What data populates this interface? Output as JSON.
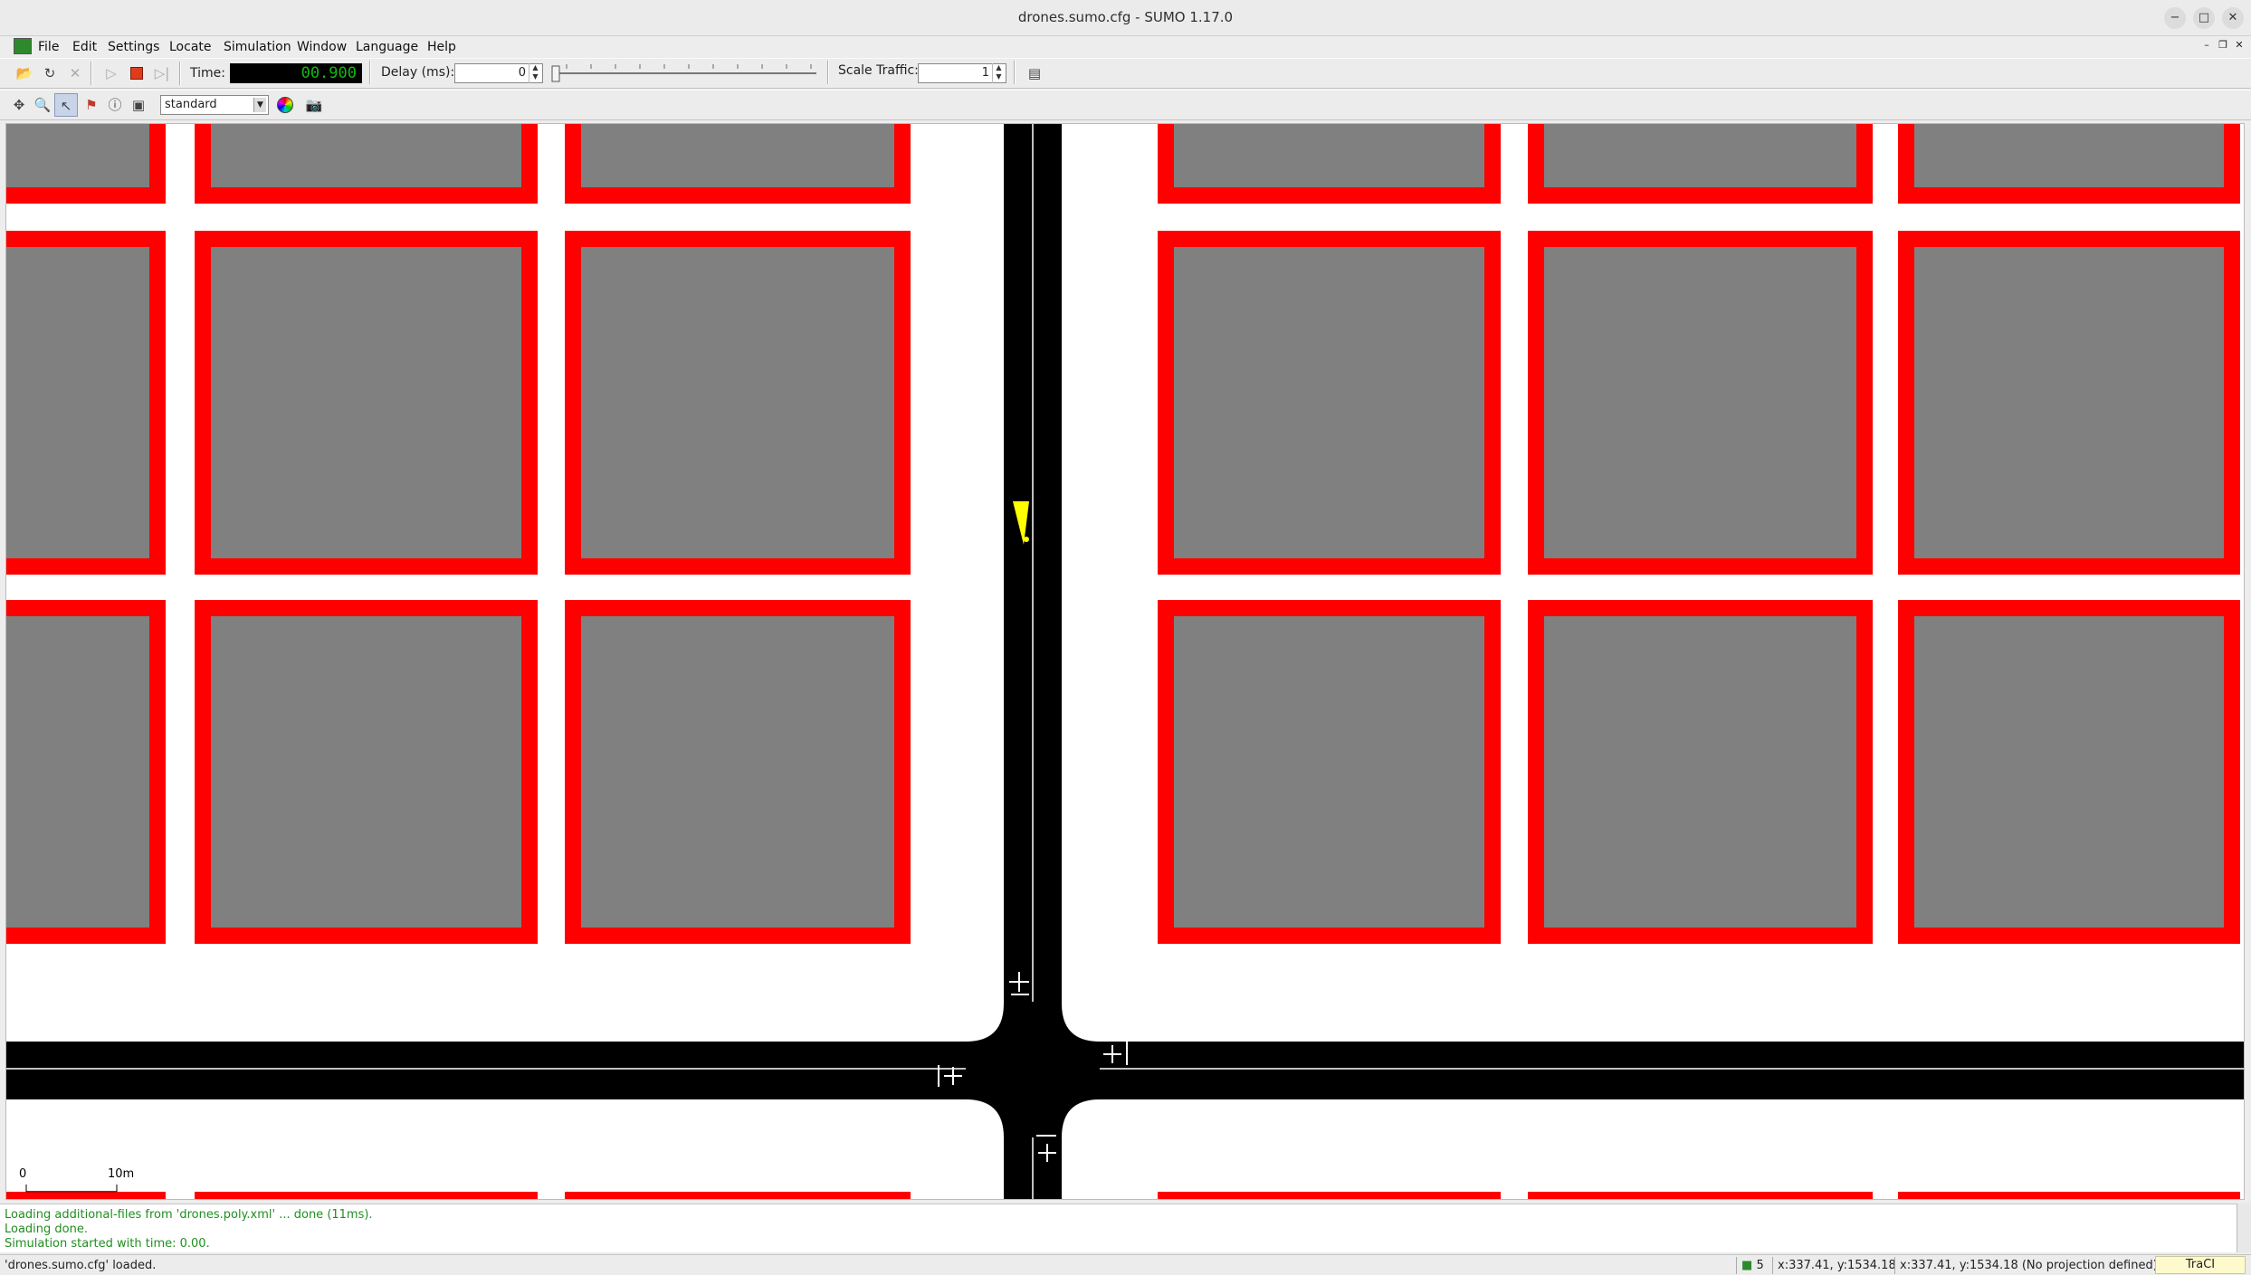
{
  "window": {
    "title": "drones.sumo.cfg - SUMO 1.17.0",
    "controls": [
      "−",
      "□",
      "✕"
    ]
  },
  "menu": {
    "items": [
      "File",
      "Edit",
      "Settings",
      "Locate",
      "Simulation",
      "Window",
      "Language",
      "Help"
    ]
  },
  "toolbar": {
    "time_label": "Time:",
    "time_value": "00.900",
    "delay_label": "Delay (ms):",
    "delay_value": "0",
    "scale_label": "Scale Traffic:",
    "scale_value": "1"
  },
  "view_toolbar": {
    "scheme": "standard"
  },
  "scale_bar": {
    "start": "0",
    "end": "10m"
  },
  "messages": [
    "Loading additional-files from 'drones.poly.xml' ... done (11ms).",
    "Loading done.",
    "Simulation started with time: 0.00."
  ],
  "status": {
    "message": "'drones.sumo.cfg' loaded.",
    "vehicle_count": "5",
    "coords": "x:337.41, y:1534.18",
    "coords_geo": "x:337.41, y:1534.18 (No projection defined)",
    "traci": "TraCI"
  },
  "colors": {
    "building_fill": "#808080",
    "building_border": "#ff0000",
    "road": "#000000",
    "vehicle": "#ffff00",
    "message_text": "#1f8f1f",
    "time_text": "#14b814"
  },
  "icons": {
    "app": "sumo-app-icon",
    "open": "open-folder-icon",
    "reload": "reload-icon",
    "run": "play-icon",
    "stop": "stop-icon",
    "step": "step-icon",
    "recenter": "recenter-icon",
    "zoom": "zoom-icon",
    "select": "select-icon",
    "locate": "locate-icon",
    "inspect": "inspect-icon",
    "editbreak": "edit-view-icon",
    "color": "color-wheel-icon",
    "snapshot": "camera-icon"
  }
}
